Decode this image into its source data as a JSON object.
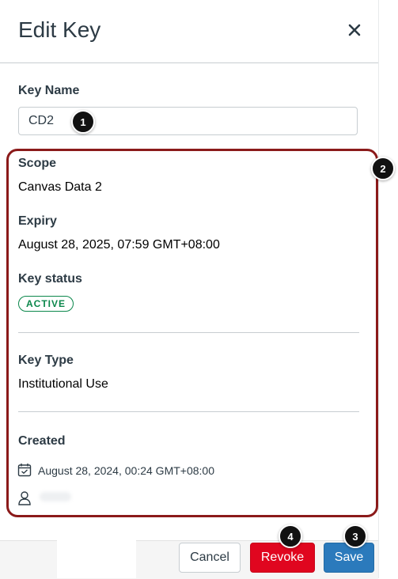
{
  "header": {
    "title": "Edit Key"
  },
  "key_name": {
    "label": "Key Name",
    "value": "CD2"
  },
  "scope": {
    "label": "Scope",
    "value": "Canvas Data 2"
  },
  "expiry": {
    "label": "Expiry",
    "value": "August 28, 2025, 07:59 GMT+08:00"
  },
  "status": {
    "label": "Key status",
    "value": "ACTIVE",
    "color": "#0b874b"
  },
  "key_type": {
    "label": "Key Type",
    "value": "Institutional Use"
  },
  "created": {
    "label": "Created",
    "date": "August 28, 2024, 00:24 GMT+08:00",
    "date_icon": "calendar-icon",
    "user_icon": "user-icon"
  },
  "callouts": [
    "1",
    "2",
    "3",
    "4"
  ],
  "footer": {
    "cancel_label": "Cancel",
    "revoke_label": "Revoke",
    "save_label": "Save"
  },
  "colors": {
    "revoke": "#e0061f",
    "save": "#2b7abc",
    "callout_border": "#8b1a1a"
  }
}
